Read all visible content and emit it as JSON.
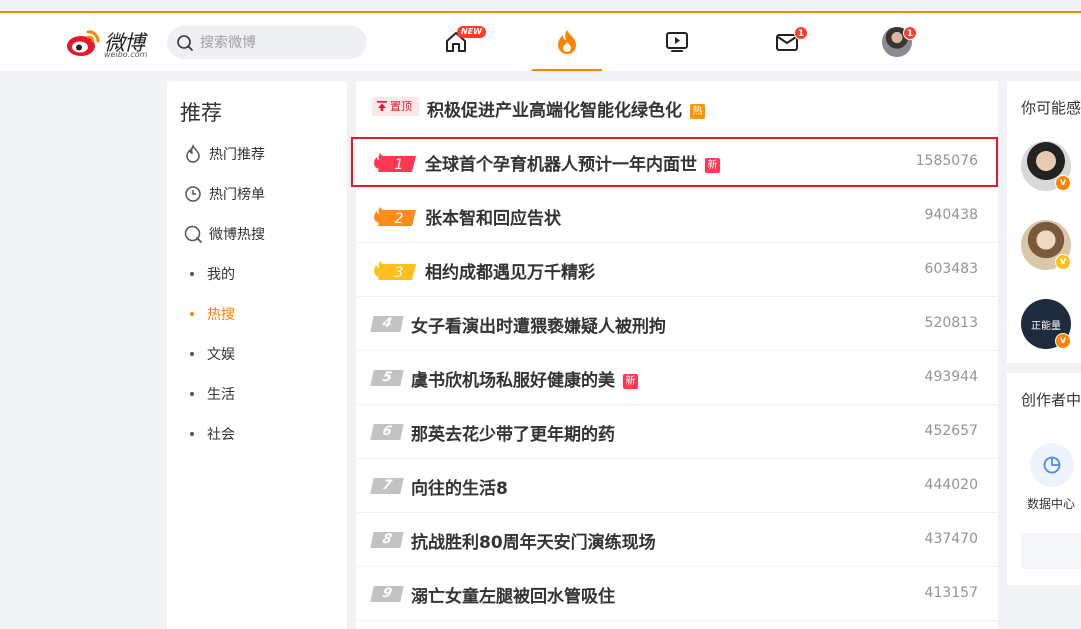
{
  "brand": {
    "logo_text": "微博",
    "logo_sub": "weibo.com"
  },
  "search": {
    "placeholder": "搜索微博"
  },
  "nav": {
    "home_badge": "NEW",
    "mail_badge": "1",
    "profile_badge": "1"
  },
  "sidebar": {
    "title": "推荐",
    "items": [
      {
        "label": "热门推荐",
        "icon": "fire-outline-icon"
      },
      {
        "label": "热门榜单",
        "icon": "clock-icon"
      },
      {
        "label": "微博热搜",
        "icon": "search-circle-icon"
      }
    ],
    "subitems": [
      {
        "label": "我的"
      },
      {
        "label": "热搜",
        "active": true
      },
      {
        "label": "文娱"
      },
      {
        "label": "生活"
      },
      {
        "label": "社会"
      }
    ]
  },
  "hot_list": {
    "pinned": {
      "tag": "置顶",
      "title": "积极促进产业高端化智能化绿色化",
      "badge": "热"
    },
    "rows": [
      {
        "rank": "1",
        "title": "全球首个孕育机器人预计一年内面世",
        "badge": "新",
        "count": "1585076"
      },
      {
        "rank": "2",
        "title": "张本智和回应告状",
        "count": "940438"
      },
      {
        "rank": "3",
        "title": "相约成都遇见万千精彩",
        "count": "603483"
      },
      {
        "rank": "4",
        "title": "女子看演出时遭猥亵嫌疑人被刑拘",
        "count": "520813"
      },
      {
        "rank": "5",
        "title": "虞书欣机场私服好健康的美",
        "badge": "新",
        "count": "493944"
      },
      {
        "rank": "6",
        "title": "那英去花少带了更年期的药",
        "count": "452657"
      },
      {
        "rank": "7",
        "title": "向往的生活8",
        "count": "444020"
      },
      {
        "rank": "8",
        "title": "抗战胜利80周年天安门演练现场",
        "count": "437470"
      },
      {
        "rank": "9",
        "title": "溺亡女童左腿被回水管吸住",
        "count": "413157"
      }
    ]
  },
  "right_panel": {
    "suggest_title": "你可能感",
    "avatar3_text": "正能量",
    "creator_title": "创作者中",
    "data_center_label": "数据中心"
  },
  "colors": {
    "accent": "#ff8200",
    "hot_red": "#e6162d",
    "new_tag": "#ff3852",
    "hot_tag": "#ff9406"
  }
}
